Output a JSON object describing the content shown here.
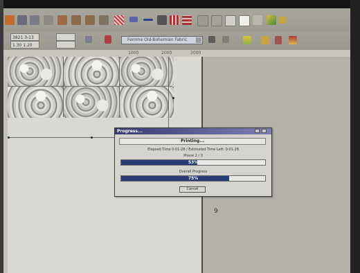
{
  "toolbar": {
    "style_combo_text": "Femme Old-Bohemian Fabric",
    "field_a": "3821 3-13",
    "field_b": "1.30 1.20"
  },
  "ruler": {
    "ticks": [
      "1000",
      "2000",
      "3000"
    ]
  },
  "side_mark": "9",
  "progress_dialog": {
    "title": "Progress...",
    "status": "Printing...",
    "elapsed": "Elapsed Time 0:01:28 / Estimated Time Left: 0:01:28",
    "phase_label": "Phase 2 / 3",
    "phase_percent_text": "53%",
    "phase_progress": 0.53,
    "overall_label": "Overall Progress",
    "overall_percent_text": "75%",
    "overall_progress": 0.75,
    "cancel_label": "Cancel"
  },
  "colors": {
    "title_bar": "#3a3a72",
    "progress_fill": "#2b3d78"
  }
}
